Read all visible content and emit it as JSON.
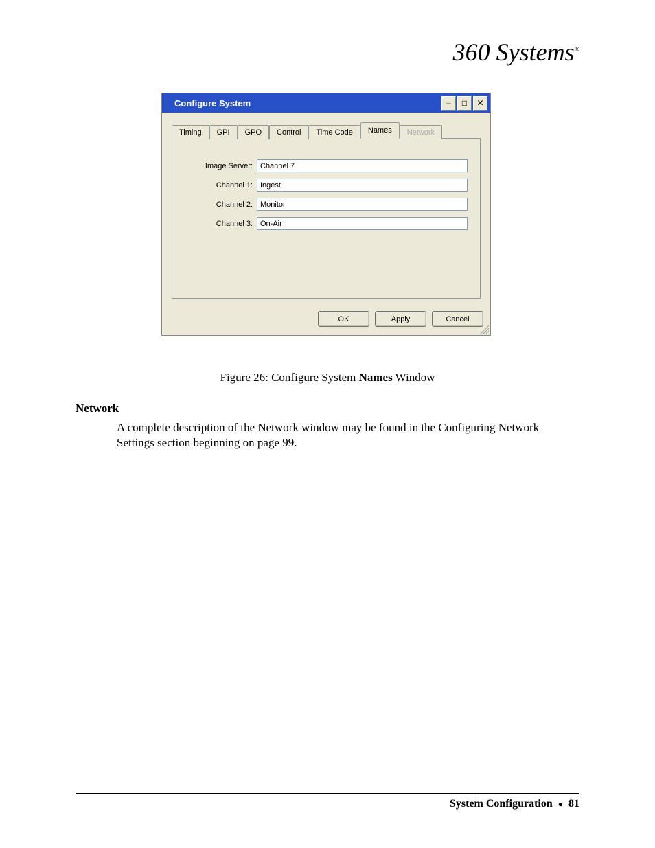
{
  "logo": {
    "text": "360 Systems",
    "mark": "®"
  },
  "dialog": {
    "title": "Configure System",
    "tabs": [
      {
        "label": "Timing"
      },
      {
        "label": "GPI"
      },
      {
        "label": "GPO"
      },
      {
        "label": "Control"
      },
      {
        "label": "Time Code"
      },
      {
        "label": "Names"
      },
      {
        "label": "Network"
      }
    ],
    "fields": {
      "image_server": {
        "label": "Image Server:",
        "value": "Channel 7"
      },
      "channel1": {
        "label": "Channel 1:",
        "value": "Ingest"
      },
      "channel2": {
        "label": "Channel 2:",
        "value": "Monitor"
      },
      "channel3": {
        "label": "Channel 3:",
        "value": "On-Air"
      }
    },
    "buttons": {
      "ok": "OK",
      "apply": "Apply",
      "cancel": "Cancel"
    }
  },
  "caption": {
    "prefix": "Figure 26:  Configure System ",
    "bold": "Names",
    "suffix": " Window"
  },
  "section": {
    "heading": "Network",
    "body": "A complete description of the Network window may be found in the Configuring Network Settings section beginning on page 99."
  },
  "footer": {
    "section": "System Configuration",
    "sep": "●",
    "page": "81"
  }
}
